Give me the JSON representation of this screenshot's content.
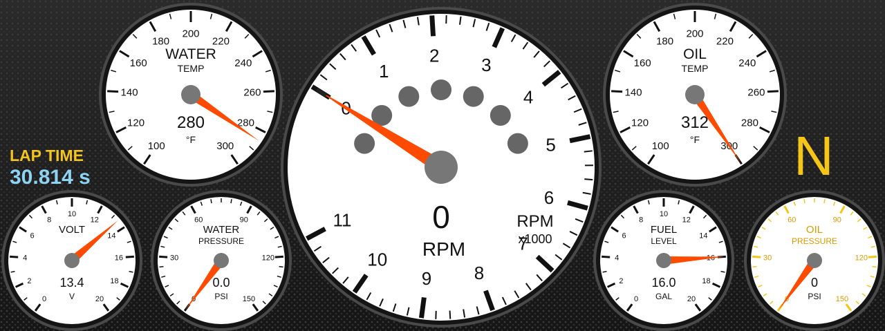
{
  "lap_time": {
    "label": "LAP TIME",
    "value": "30.814 s"
  },
  "gear": "N",
  "colors": {
    "needle": "#ff4a00",
    "accent": "#f5c518",
    "lap_value": "#8fd3f4"
  },
  "gauges": [
    {
      "id": "rpm",
      "title": "RPM",
      "subtitle": "",
      "readout": "0",
      "unit": "RPM",
      "unit2": "RPM",
      "unit3": "x1000",
      "ticks": [
        "0",
        "1",
        "2",
        "3",
        "4",
        "5",
        "6",
        "7",
        "8",
        "9",
        "10",
        "11"
      ],
      "value": 0,
      "min": 0,
      "max": 11,
      "face": "white",
      "shift_lights": 7
    },
    {
      "id": "water-temp",
      "title": "WATER",
      "subtitle": "TEMP",
      "readout": "280",
      "unit": "°F",
      "ticks": [
        "100",
        "120",
        "140",
        "160",
        "180",
        "200",
        "220",
        "240",
        "260",
        "280",
        "300"
      ],
      "value": 285,
      "min": 100,
      "max": 300,
      "face": "white"
    },
    {
      "id": "oil-temp",
      "title": "OIL",
      "subtitle": "TEMP",
      "readout": "312",
      "unit": "°F",
      "ticks": [
        "100",
        "120",
        "140",
        "160",
        "180",
        "200",
        "220",
        "240",
        "260",
        "280",
        "300"
      ],
      "value": 300,
      "min": 100,
      "max": 300,
      "face": "white"
    },
    {
      "id": "volt",
      "title": "VOLT",
      "subtitle": "",
      "readout": "13.4",
      "unit": "V",
      "ticks": [
        "0",
        "2",
        "4",
        "6",
        "8",
        "10",
        "12",
        "14",
        "16",
        "18",
        "20"
      ],
      "value": 13.4,
      "min": 0,
      "max": 20,
      "face": "white"
    },
    {
      "id": "water-pressure",
      "title": "WATER",
      "subtitle": "PRESSURE",
      "readout": "0.0",
      "unit": "PSI",
      "ticks": [
        "0",
        "30",
        "60",
        "90",
        "120",
        "150"
      ],
      "value": 0,
      "min": 0,
      "max": 150,
      "face": "white"
    },
    {
      "id": "fuel-level",
      "title": "FUEL",
      "subtitle": "LEVEL",
      "readout": "16.0",
      "unit": "GAL",
      "ticks": [
        "0",
        "2",
        "4",
        "6",
        "8",
        "10",
        "12",
        "14",
        "16",
        "18",
        "20"
      ],
      "value": 16,
      "min": 0,
      "max": 20,
      "face": "white"
    },
    {
      "id": "oil-pressure",
      "title": "OIL",
      "subtitle": "PRESSURE",
      "readout": "0",
      "unit": "PSI",
      "ticks": [
        "0",
        "30",
        "60",
        "90",
        "120",
        "150"
      ],
      "value": 0,
      "min": 0,
      "max": 150,
      "face": "yellow"
    }
  ]
}
